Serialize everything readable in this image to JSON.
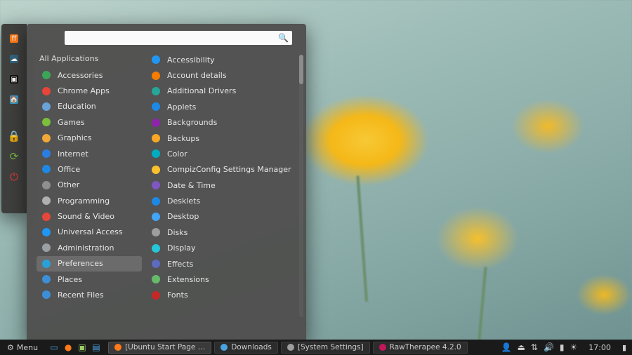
{
  "menu": {
    "search_placeholder": "",
    "categories_header": "All Applications",
    "categories": [
      {
        "label": "Accessories",
        "icon": "accessories-icon",
        "color": "#3aa757"
      },
      {
        "label": "Chrome Apps",
        "icon": "chrome-icon",
        "color": "#e8443a"
      },
      {
        "label": "Education",
        "icon": "education-icon",
        "color": "#6aa2d8"
      },
      {
        "label": "Games",
        "icon": "games-icon",
        "color": "#7bbf3a"
      },
      {
        "label": "Graphics",
        "icon": "graphics-icon",
        "color": "#f0a836"
      },
      {
        "label": "Internet",
        "icon": "internet-icon",
        "color": "#2b7de1"
      },
      {
        "label": "Office",
        "icon": "office-icon",
        "color": "#1e88e5"
      },
      {
        "label": "Other",
        "icon": "other-icon",
        "color": "#8f8f8f"
      },
      {
        "label": "Programming",
        "icon": "programming-icon",
        "color": "#b0b0b0"
      },
      {
        "label": "Sound & Video",
        "icon": "sound-video-icon",
        "color": "#e5473b"
      },
      {
        "label": "Universal Access",
        "icon": "universal-icon",
        "color": "#2196f3"
      },
      {
        "label": "Administration",
        "icon": "admin-icon",
        "color": "#9aa0a6"
      },
      {
        "label": "Preferences",
        "icon": "preferences-icon",
        "color": "#2aa0d8",
        "selected": true
      },
      {
        "label": "Places",
        "icon": "places-icon",
        "color": "#3c8fd6"
      },
      {
        "label": "Recent Files",
        "icon": "recent-icon",
        "color": "#3c8fd6"
      }
    ],
    "apps": [
      {
        "label": "Accessibility",
        "icon": "accessibility-icon",
        "color": "#2196f3"
      },
      {
        "label": "Account details",
        "icon": "account-icon",
        "color": "#f57c00"
      },
      {
        "label": "Additional Drivers",
        "icon": "drivers-icon",
        "color": "#26a69a"
      },
      {
        "label": "Applets",
        "icon": "applets-icon",
        "color": "#1e88e5"
      },
      {
        "label": "Backgrounds",
        "icon": "backgrounds-icon",
        "color": "#8e24aa"
      },
      {
        "label": "Backups",
        "icon": "backups-icon",
        "color": "#f9a825"
      },
      {
        "label": "Color",
        "icon": "color-icon",
        "color": "#00acc1"
      },
      {
        "label": "CompizConfig Settings Manager",
        "icon": "compiz-icon",
        "color": "#fbc02d"
      },
      {
        "label": "Date & Time",
        "icon": "date-time-icon",
        "color": "#7e57c2"
      },
      {
        "label": "Desklets",
        "icon": "desklets-icon",
        "color": "#1e88e5"
      },
      {
        "label": "Desktop",
        "icon": "desktop-icon",
        "color": "#42a5f5"
      },
      {
        "label": "Disks",
        "icon": "disks-icon",
        "color": "#9e9e9e"
      },
      {
        "label": "Display",
        "icon": "display-icon",
        "color": "#26c6da"
      },
      {
        "label": "Effects",
        "icon": "effects-icon",
        "color": "#5c6bc0"
      },
      {
        "label": "Extensions",
        "icon": "extensions-icon",
        "color": "#66bb6a"
      },
      {
        "label": "Fonts",
        "icon": "fonts-icon",
        "color": "#c62828"
      }
    ]
  },
  "favorites": [
    {
      "name": "firefox-icon",
      "glyph": "ff",
      "bg": "#ff7a18"
    },
    {
      "name": "steam-icon",
      "glyph": "☁",
      "bg": "#35637d"
    },
    {
      "name": "terminal-icon",
      "glyph": "▣",
      "bg": "#111111"
    },
    {
      "name": "files-icon",
      "glyph": "🏠",
      "bg": "#2b9edb"
    }
  ],
  "sessionButtons": [
    {
      "name": "lock-icon",
      "glyph": "🔒",
      "color": "#e53935"
    },
    {
      "name": "logout-icon",
      "glyph": "⟳",
      "color": "#7cb342"
    },
    {
      "name": "power-icon",
      "glyph": "⏻",
      "color": "#e53935"
    }
  ],
  "panel": {
    "menu_label": "Menu",
    "quicklaunch": [
      {
        "name": "show-desktop-icon",
        "glyph": "▭",
        "color": "#4aa3df"
      },
      {
        "name": "firefox-icon",
        "glyph": "●",
        "color": "#ff7a18"
      },
      {
        "name": "terminal-icon",
        "glyph": "▣",
        "color": "#9ccc65"
      },
      {
        "name": "files-icon",
        "glyph": "▤",
        "color": "#4aa3df"
      }
    ],
    "tasks": [
      {
        "label": "[Ubuntu Start Page …",
        "icon_color": "#ff7a18",
        "active": true
      },
      {
        "label": "Downloads",
        "icon_color": "#4aa3df"
      },
      {
        "label": "[System Settings]",
        "icon_color": "#9e9e9e"
      },
      {
        "label": "RawTherapee 4.2.0",
        "icon_color": "#c2185b"
      }
    ],
    "tray": [
      {
        "name": "user-icon",
        "glyph": "👤"
      },
      {
        "name": "removable-icon",
        "glyph": "⏏"
      },
      {
        "name": "network-icon",
        "glyph": "⇅"
      },
      {
        "name": "volume-icon",
        "glyph": "🔊"
      },
      {
        "name": "battery-icon",
        "glyph": "▮"
      },
      {
        "name": "brightness-icon",
        "glyph": "☀"
      }
    ],
    "clock": "17:00"
  }
}
